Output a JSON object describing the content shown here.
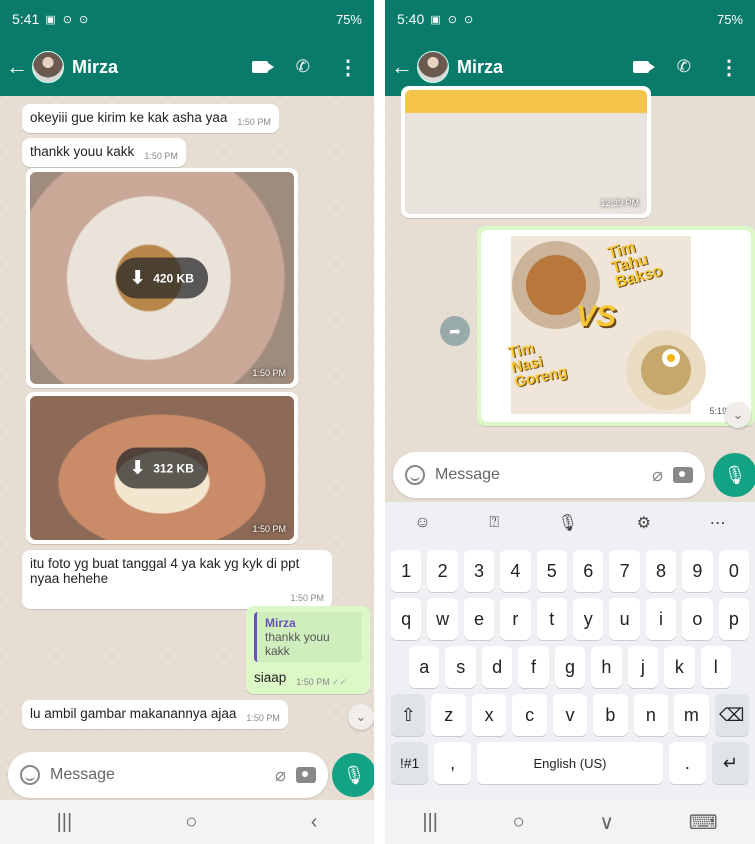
{
  "left": {
    "status": {
      "time": "5:41",
      "battery": "75%",
      "icons": "▣ ⊙ ⊙"
    },
    "header": {
      "back": "←",
      "contact": "Mirza",
      "menu": "⋮"
    },
    "messages": [
      {
        "text": "okeyiii gue kirim ke kak asha yaa",
        "time": "1:50 PM"
      },
      {
        "text": "thankk youu kakk",
        "time": "1:50 PM"
      },
      {
        "size": "420 KB",
        "time": "1:50 PM"
      },
      {
        "size": "312 KB",
        "time": "1:50 PM"
      },
      {
        "text": "itu foto yg buat tanggal 4 ya kak yg kyk di ppt nyaa hehehe",
        "time": "1:50 PM"
      },
      {
        "quote_name": "Mirza",
        "quote_text": "thankk youu kakk",
        "text": "siaap",
        "time": "1:50 PM"
      },
      {
        "text": "lu ambil gambar makanannya ajaa",
        "time": "1:50 PM"
      }
    ],
    "composer": {
      "placeholder": "Message"
    }
  },
  "right": {
    "status": {
      "time": "5:40",
      "battery": "75%",
      "icons": "▣ ⊙ ⊙"
    },
    "header": {
      "back": "←",
      "contact": "Mirza",
      "menu": "⋮"
    },
    "img_time_1": "12:39 PM",
    "img_time_2": "5:19 PM",
    "poster_lines": [
      "Tim",
      "Tahu",
      "Bakso",
      "VS",
      "Tim",
      "Nasi",
      "Goreng"
    ],
    "composer": {
      "placeholder": "Message"
    },
    "keyboard": {
      "row1": [
        "1",
        "2",
        "3",
        "4",
        "5",
        "6",
        "7",
        "8",
        "9",
        "0"
      ],
      "row2": [
        "q",
        "w",
        "e",
        "r",
        "t",
        "y",
        "u",
        "i",
        "o",
        "p"
      ],
      "row3": [
        "a",
        "s",
        "d",
        "f",
        "g",
        "h",
        "j",
        "k",
        "l"
      ],
      "row4": [
        "⇧",
        "z",
        "x",
        "c",
        "v",
        "b",
        "n",
        "m",
        "⌫"
      ],
      "row5": [
        "!#1",
        ",",
        "English (US)",
        ".",
        "↵"
      ],
      "tools": [
        "☺",
        "⍰",
        "🎙",
        "⚙",
        "⋯"
      ]
    }
  },
  "nav": [
    "|||",
    "○",
    "‹"
  ],
  "nav_right": [
    "|||",
    "○",
    "∨",
    "⌨"
  ],
  "colors": {
    "header": "#0a7a6a",
    "accent": "#13a384",
    "outgoing": "#dcf8c6",
    "chat_bg": "#e6ddd3"
  }
}
